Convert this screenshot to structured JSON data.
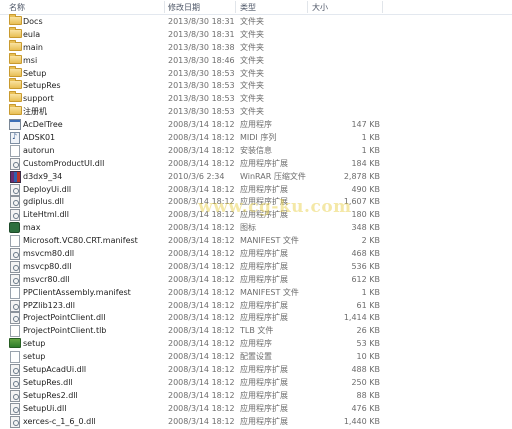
{
  "columns": {
    "name": "名称",
    "date": "修改日期",
    "type": "类型",
    "size": "大小"
  },
  "watermark": "www.cg-ku.com",
  "colors": {
    "header_border": "#e3e8ef",
    "folder": "#e8bf55",
    "text": "#1e1e1e",
    "meta_text": "#6d6d6d"
  },
  "files": [
    {
      "icon": "folder-icon",
      "name": "Docs",
      "date": "2013/8/30 18:31",
      "type": "文件夹",
      "size": ""
    },
    {
      "icon": "folder-icon",
      "name": "eula",
      "date": "2013/8/30 18:31",
      "type": "文件夹",
      "size": ""
    },
    {
      "icon": "folder-icon",
      "name": "main",
      "date": "2013/8/30 18:38",
      "type": "文件夹",
      "size": ""
    },
    {
      "icon": "folder-icon",
      "name": "msi",
      "date": "2013/8/30 18:46",
      "type": "文件夹",
      "size": ""
    },
    {
      "icon": "folder-icon",
      "name": "Setup",
      "date": "2013/8/30 18:53",
      "type": "文件夹",
      "size": ""
    },
    {
      "icon": "folder-icon",
      "name": "SetupRes",
      "date": "2013/8/30 18:53",
      "type": "文件夹",
      "size": ""
    },
    {
      "icon": "folder-icon",
      "name": "support",
      "date": "2013/8/30 18:53",
      "type": "文件夹",
      "size": ""
    },
    {
      "icon": "folder-icon",
      "name": "注册机",
      "date": "2013/8/30 18:53",
      "type": "文件夹",
      "size": ""
    },
    {
      "icon": "app-icon",
      "name": "AcDelTree",
      "date": "2008/3/14 18:12",
      "type": "应用程序",
      "size": "147 KB"
    },
    {
      "icon": "midi-icon",
      "name": "ADSK01",
      "date": "2008/3/14 18:12",
      "type": "MIDI 序列",
      "size": "1 KB"
    },
    {
      "icon": "file-icon",
      "name": "autorun",
      "date": "2008/3/14 18:12",
      "type": "安装信息",
      "size": "1 KB"
    },
    {
      "icon": "dll-icon",
      "name": "CustomProductUI.dll",
      "date": "2008/3/14 18:12",
      "type": "应用程序扩展",
      "size": "184 KB"
    },
    {
      "icon": "rar-icon",
      "name": "d3dx9_34",
      "date": "2010/3/6 2:34",
      "type": "WinRAR 压缩文件",
      "size": "2,878 KB"
    },
    {
      "icon": "dll-icon",
      "name": "DeployUi.dll",
      "date": "2008/3/14 18:12",
      "type": "应用程序扩展",
      "size": "490 KB"
    },
    {
      "icon": "dll-icon",
      "name": "gdiplus.dll",
      "date": "2008/3/14 18:12",
      "type": "应用程序扩展",
      "size": "1,607 KB"
    },
    {
      "icon": "dll-icon",
      "name": "LiteHtml.dll",
      "date": "2008/3/14 18:12",
      "type": "应用程序扩展",
      "size": "180 KB"
    },
    {
      "icon": "ico-icon",
      "name": "max",
      "date": "2008/3/14 18:12",
      "type": "图标",
      "size": "348 KB"
    },
    {
      "icon": "file-icon",
      "name": "Microsoft.VC80.CRT.manifest",
      "date": "2008/3/14 18:12",
      "type": "MANIFEST 文件",
      "size": "2 KB"
    },
    {
      "icon": "dll-icon",
      "name": "msvcm80.dll",
      "date": "2008/3/14 18:12",
      "type": "应用程序扩展",
      "size": "468 KB"
    },
    {
      "icon": "dll-icon",
      "name": "msvcp80.dll",
      "date": "2008/3/14 18:12",
      "type": "应用程序扩展",
      "size": "536 KB"
    },
    {
      "icon": "dll-icon",
      "name": "msvcr80.dll",
      "date": "2008/3/14 18:12",
      "type": "应用程序扩展",
      "size": "612 KB"
    },
    {
      "icon": "file-icon",
      "name": "PPClientAssembly.manifest",
      "date": "2008/3/14 18:12",
      "type": "MANIFEST 文件",
      "size": "1 KB"
    },
    {
      "icon": "dll-icon",
      "name": "PPZlib123.dll",
      "date": "2008/3/14 18:12",
      "type": "应用程序扩展",
      "size": "61 KB"
    },
    {
      "icon": "dll-icon",
      "name": "ProjectPointClient.dll",
      "date": "2008/3/14 18:12",
      "type": "应用程序扩展",
      "size": "1,414 KB"
    },
    {
      "icon": "file-icon",
      "name": "ProjectPointClient.tlb",
      "date": "2008/3/14 18:12",
      "type": "TLB 文件",
      "size": "26 KB"
    },
    {
      "icon": "setup-icon",
      "name": "setup",
      "date": "2008/3/14 18:12",
      "type": "应用程序",
      "size": "53 KB"
    },
    {
      "icon": "file-icon",
      "name": "setup",
      "date": "2008/3/14 18:12",
      "type": "配置设置",
      "size": "10 KB"
    },
    {
      "icon": "dll-icon",
      "name": "SetupAcadUi.dll",
      "date": "2008/3/14 18:12",
      "type": "应用程序扩展",
      "size": "488 KB"
    },
    {
      "icon": "dll-icon",
      "name": "SetupRes.dll",
      "date": "2008/3/14 18:12",
      "type": "应用程序扩展",
      "size": "250 KB"
    },
    {
      "icon": "dll-icon",
      "name": "SetupRes2.dll",
      "date": "2008/3/14 18:12",
      "type": "应用程序扩展",
      "size": "88 KB"
    },
    {
      "icon": "dll-icon",
      "name": "SetupUi.dll",
      "date": "2008/3/14 18:12",
      "type": "应用程序扩展",
      "size": "476 KB"
    },
    {
      "icon": "dll-icon",
      "name": "xerces-c_1_6_0.dll",
      "date": "2008/3/14 18:12",
      "type": "应用程序扩展",
      "size": "1,440 KB"
    }
  ]
}
